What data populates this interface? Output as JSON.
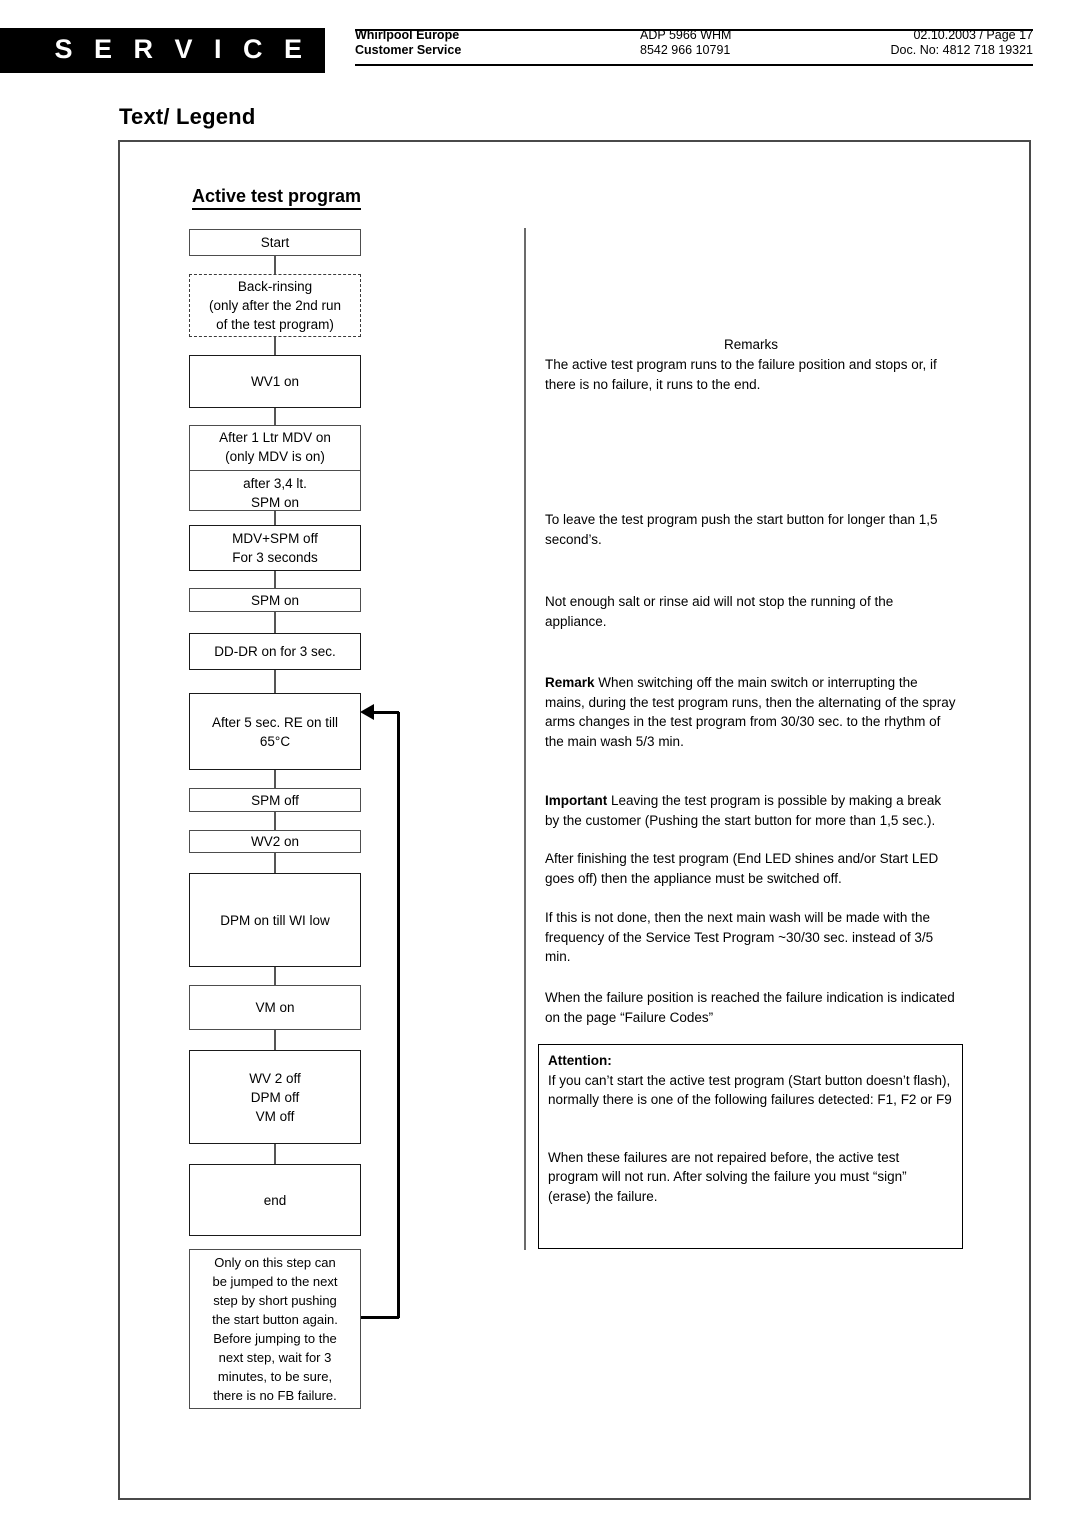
{
  "header": {
    "badge": "S E R V I C E",
    "company_line1": "Whirlpool Europe",
    "company_line2": "Customer Service",
    "model_line1": "ADP 5966 WHM",
    "model_line2": "8542 966 10791",
    "doc_line1": "02.10.2003 / Page 17",
    "doc_line2": "Doc. No: 4812 718 19321"
  },
  "title": "Text/ Legend",
  "flow": {
    "heading": "Active test program",
    "steps": [
      {
        "id": "start",
        "label": "Start"
      },
      {
        "id": "back-rinsing",
        "label": "Back-rinsing\n(only after the 2nd run\nof the test program)"
      },
      {
        "id": "wv1-on",
        "label": "WV1 on"
      },
      {
        "id": "mdv-on",
        "label": "After 1 Ltr MDV on\n(only MDV is on)"
      },
      {
        "id": "spm-on-34",
        "label": "after 3,4 lt.\nSPM on"
      },
      {
        "id": "mdv-spm-off",
        "label": "MDV+SPM off\nFor 3 seconds"
      },
      {
        "id": "spm-on",
        "label": "SPM on"
      },
      {
        "id": "dd-dr-on",
        "label": "DD-DR on for 3 sec."
      },
      {
        "id": "re-on",
        "label": "After 5 sec. RE on till\n65°C"
      },
      {
        "id": "spm-off",
        "label": "SPM off"
      },
      {
        "id": "wv2-on",
        "label": "WV2 on"
      },
      {
        "id": "dpm-on",
        "label": "DPM on till WI low"
      },
      {
        "id": "vm-on",
        "label": "VM on"
      },
      {
        "id": "all-off",
        "label": "WV 2 off\nDPM off\nVM off"
      },
      {
        "id": "end",
        "label": "end"
      },
      {
        "id": "note",
        "label": "Only on this step can\nbe jumped to the next\nstep by short pushing\nthe start button again.\nBefore jumping to the\nnext step, wait for 3\nminutes, to be sure,\nthere is no FB failure."
      }
    ]
  },
  "remarks": {
    "title": "Remarks",
    "p1": "The active test program runs to the failure position and stops or, if there is no failure, it runs to the end.",
    "p2": "To leave the test program push the start button for longer than 1,5 second’s.",
    "p3": "Not enough salt or rinse aid will not stop the running of the appliance.",
    "p4_bold": "Remark",
    "p4": " When switching off the main switch or interrupting the mains, during the test program runs, then the alternating of the spray arms changes in the test program from 30/30 sec. to the rhythm of the main wash 5/3 min.",
    "p5_bold": "Important",
    "p5": " Leaving the test program is possible by making a break by the customer (Pushing the start button for more than 1,5 sec.).",
    "p5b": "After finishing the test program (End LED shines and/or Start LED goes off) then the appliance must be switched off.",
    "p5c": "If this is not done, then the next main wash will be made with the frequency of the Service Test Program ~30/30 sec. instead of 3/5 min.",
    "p6": "When the failure position is reached the failure indication is indicated on the page “Failure Codes”"
  },
  "attention": {
    "title": "Attention:",
    "body1": "If you can’t start the active test program (Start button doesn’t flash), normally there is one of the following failures detected: F1, F2 or F9",
    "body2": "When these failures are not repaired before, the active test program will not run. After solving the failure you must “sign” (erase) the failure."
  }
}
